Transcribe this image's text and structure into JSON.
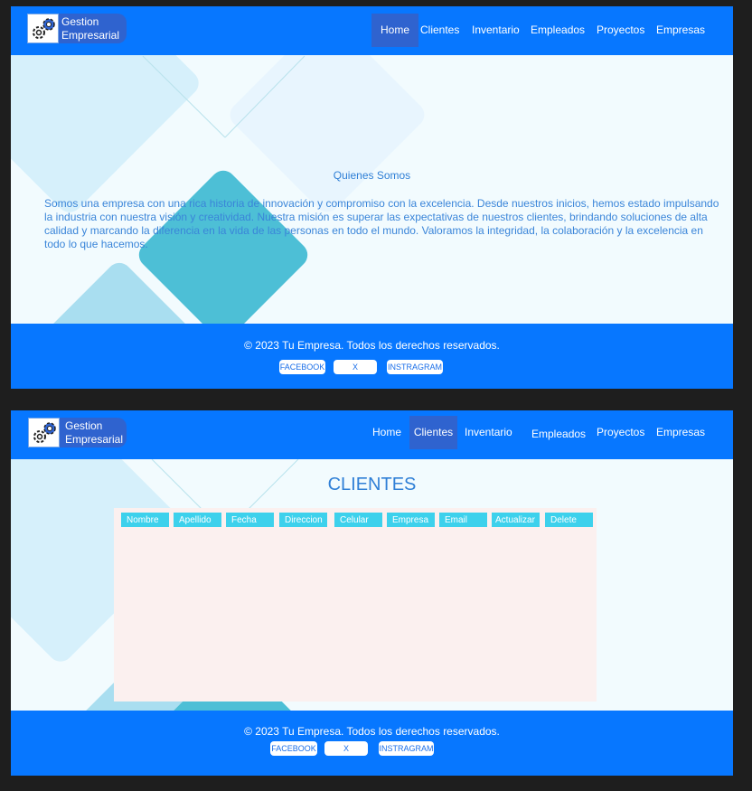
{
  "brand": {
    "line1": "Gestion",
    "line2": "Empresarial"
  },
  "nav": {
    "items": [
      "Home",
      "Clientes",
      "Inventario",
      "Empleados",
      "Proyectos",
      "Empresas"
    ]
  },
  "home": {
    "about_title": "Quienes Somos",
    "about_text": "Somos una empresa con una rica historia de innovación y compromiso con la excelencia. Desde nuestros inicios, hemos estado impulsando la industria con nuestra visión y creatividad. Nuestra misión es superar las expectativas de nuestros clientes, brindando soluciones de alta calidad y marcando la diferencia en la vida de las personas en todo el mundo. Valoramos la integridad, la colaboración y la excelencia en todo lo que hacemos."
  },
  "clientes": {
    "title": "CLIENTES",
    "columns": [
      "Nombre",
      "Apellido",
      "Fecha",
      "Direccion",
      "Celular",
      "Empresa",
      "Email",
      "Actualizar",
      "Delete"
    ]
  },
  "footer": {
    "copyright": "© 2023 Tu Empresa. Todos los derechos reservados.",
    "facebook": "FACEBOOK",
    "x": "X",
    "instagram": "INSTRAGRAM"
  },
  "colors": {
    "nav": "#0777ff",
    "active": "#2f63cf",
    "header_cell": "#3dd1ec",
    "table_bg": "#fbf0ef"
  }
}
